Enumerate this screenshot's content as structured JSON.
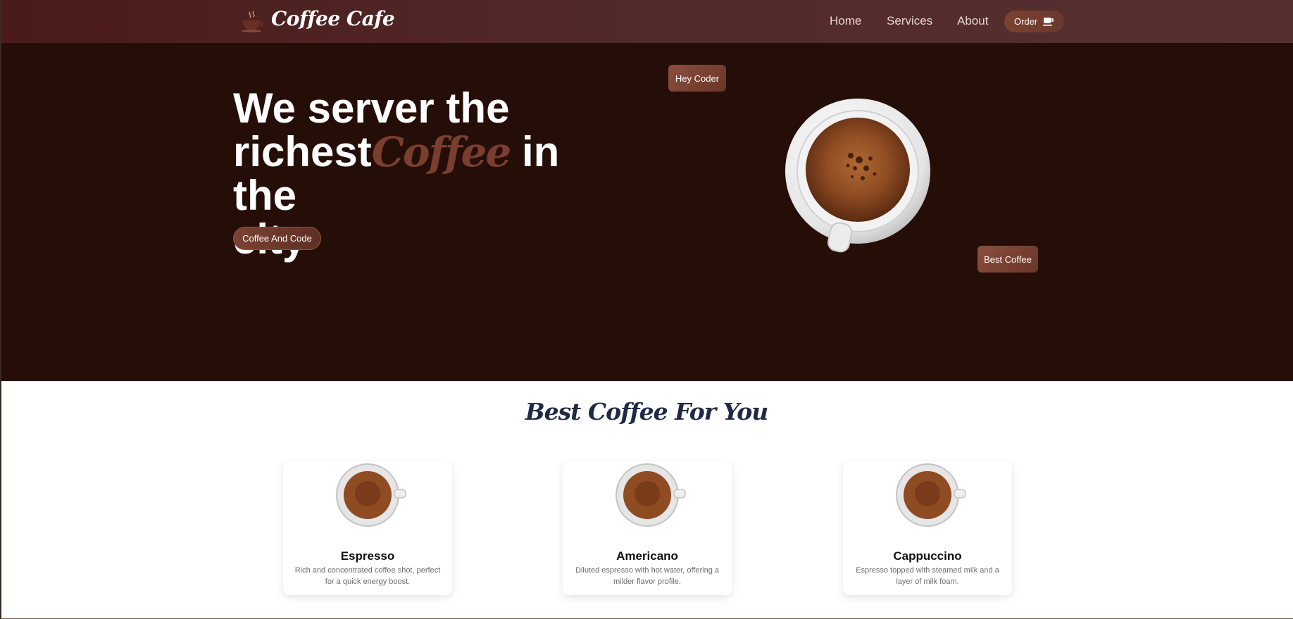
{
  "brand": {
    "name": "Coffee Cafe",
    "logo_icon": "coffee-steam-icon"
  },
  "nav": {
    "links": [
      "Home",
      "Services",
      "About"
    ],
    "order_label": "Order",
    "order_icon": "coffee-cup-icon"
  },
  "hero": {
    "line1": "We server the",
    "line2_start": "richest",
    "accent_word": "Coffee",
    "line2_end": " in the",
    "line3": "city",
    "button_label": "Coffee And Code",
    "tag_top": "Hey Coder",
    "tag_bottom": "Best Coffee"
  },
  "products": {
    "title": "Best Coffee For You",
    "items": [
      {
        "name": "Espresso",
        "desc": "Rich and concentrated coffee shot, perfect for a quick energy boost."
      },
      {
        "name": "Americano",
        "desc": "Diluted espresso with hot water, offering a milder flavor profile."
      },
      {
        "name": "Cappuccino",
        "desc": "Espresso topped with steamed milk and a layer of milk foam."
      }
    ]
  },
  "colors": {
    "nav_bg": "#4b1a1a",
    "hero_bg": "#250e08",
    "accent": "#7a3e2e",
    "title": "#1f2a44"
  }
}
